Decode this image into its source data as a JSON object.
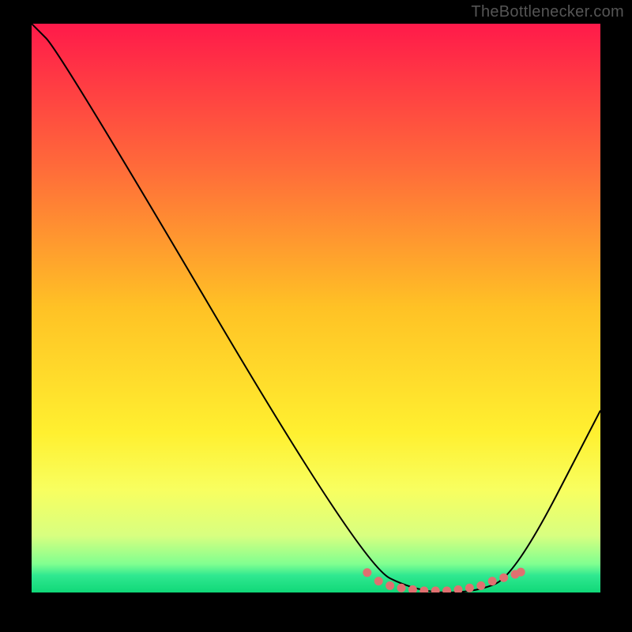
{
  "watermark": "TheBottlenecker.com",
  "chart_data": {
    "type": "line",
    "title": "",
    "xlabel": "",
    "ylabel": "",
    "xlim": [
      0,
      100
    ],
    "ylim": [
      0,
      100
    ],
    "series": [
      {
        "name": "curve",
        "x": [
          0,
          5,
          58,
          68,
          78,
          85,
          100
        ],
        "y": [
          100,
          95,
          5,
          0,
          0,
          3,
          32
        ]
      }
    ],
    "markers": {
      "name": "bottom-dots",
      "color": "#e07070",
      "x": [
        59,
        61,
        63,
        65,
        67,
        69,
        71,
        73,
        75,
        77,
        79,
        81,
        83,
        85,
        86
      ],
      "y": [
        3.5,
        2.0,
        1.2,
        0.8,
        0.5,
        0.3,
        0.3,
        0.3,
        0.5,
        0.8,
        1.2,
        2.0,
        2.6,
        3.2,
        3.6
      ]
    },
    "gradient_stops": [
      {
        "offset": 0.0,
        "color": "#ff1a4a"
      },
      {
        "offset": 0.25,
        "color": "#ff6a3a"
      },
      {
        "offset": 0.5,
        "color": "#ffc225"
      },
      {
        "offset": 0.72,
        "color": "#fff030"
      },
      {
        "offset": 0.82,
        "color": "#f8ff60"
      },
      {
        "offset": 0.9,
        "color": "#d8ff80"
      },
      {
        "offset": 0.95,
        "color": "#80ff90"
      },
      {
        "offset": 0.97,
        "color": "#30e890"
      },
      {
        "offset": 1.0,
        "color": "#10d878"
      }
    ]
  }
}
